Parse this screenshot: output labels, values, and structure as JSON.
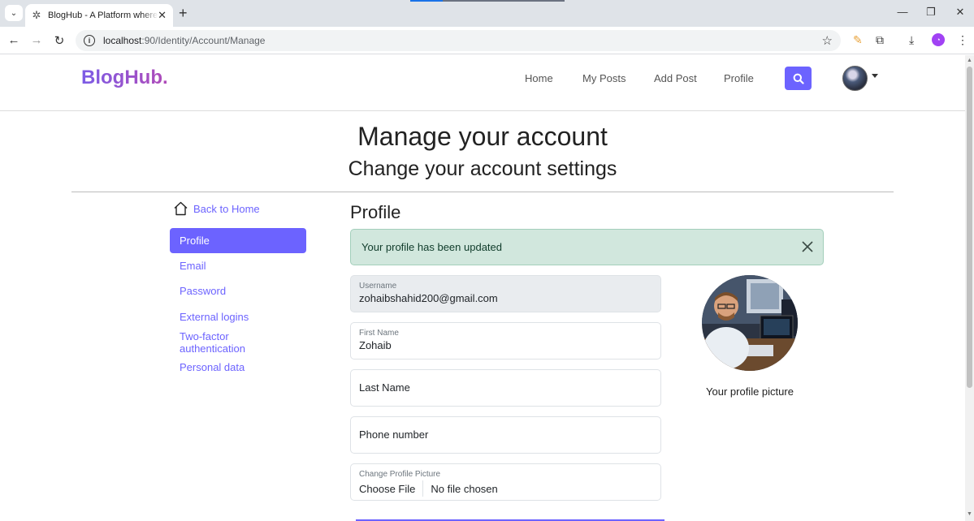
{
  "browser": {
    "tab_title": "BlogHub - A Platform where yo",
    "url_host": "localhost",
    "url_path": ":90/Identity/Account/Manage"
  },
  "navbar": {
    "brand": "BlogHub.",
    "links": [
      "Home",
      "My Posts",
      "Add Post",
      "Profile"
    ]
  },
  "header": {
    "title": "Manage your account",
    "subtitle": "Change your account settings"
  },
  "sidebar": {
    "back_label": "Back to Home",
    "items": [
      {
        "label": "Profile",
        "active": true
      },
      {
        "label": "Email",
        "active": false
      },
      {
        "label": "Password",
        "active": false
      },
      {
        "label": "External logins",
        "active": false
      },
      {
        "label": "Two-factor authentication",
        "active": false
      },
      {
        "label": "Personal data",
        "active": false
      }
    ]
  },
  "profile": {
    "section_title": "Profile",
    "alert": "Your profile has been updated",
    "username_label": "Username",
    "username_value": "zohaibshahid200@gmail.com",
    "first_name_label": "First Name",
    "first_name_value": "Zohaib",
    "last_name_placeholder": "Last Name",
    "phone_placeholder": "Phone number",
    "picture_label": "Change Profile Picture",
    "choose_file": "Choose File",
    "no_file": "No file chosen",
    "picture_caption": "Your profile picture"
  },
  "colors": {
    "accent": "#6c63ff",
    "alert_bg": "#d1e7dd"
  }
}
